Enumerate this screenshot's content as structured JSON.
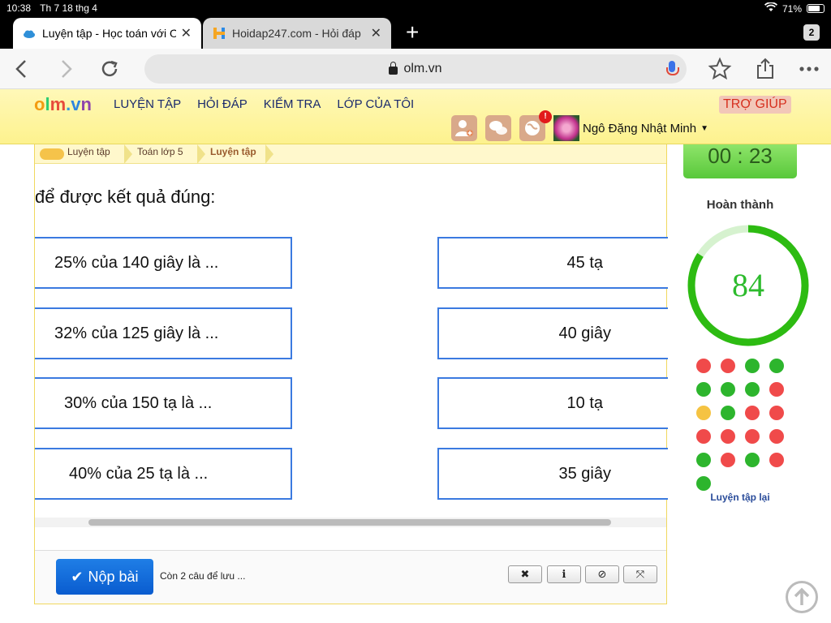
{
  "status": {
    "time": "10:38",
    "date": "Th 7 18 thg 4",
    "battery": "71%"
  },
  "tabs": [
    {
      "title": "Luyện tập - Học toán với O",
      "close": "✕"
    },
    {
      "title": "Hoidap247.com - Hỏi đáp",
      "close": "✕"
    }
  ],
  "tab_count": "2",
  "browser": {
    "url": "olm.vn",
    "new_tab": "+"
  },
  "site": {
    "logo": {
      "o": "o",
      "l": "l",
      "m": "m",
      "dot": ".",
      "v": "v",
      "n": "n"
    },
    "nav": [
      "LUYỆN TẬP",
      "HỎI ĐÁP",
      "KIỂM TRA",
      "LỚP CỦA TÔI"
    ],
    "help": "TRỢ GIÚP",
    "notification_badge": "!",
    "user_name": "Ngô Đặng Nhật Minh"
  },
  "breadcrumb": [
    "Luyện tập",
    "Toán lớp 5",
    "Luyện tập"
  ],
  "question_text": "để được kết quả đúng:",
  "left_items": [
    "25% của 140 giây là ...",
    "32% của 125 giây là ...",
    "30% của 150 tạ là ...",
    "40% của 25 tạ là ..."
  ],
  "right_items": [
    "45 tạ",
    "40 giây",
    "10 tạ",
    "35 giây"
  ],
  "footer": {
    "submit_label": "Nộp bài",
    "remaining": "Còn 2 câu để lưu ...",
    "tools": [
      "✖",
      "ℹ",
      "⊘",
      "⤧"
    ]
  },
  "sidebar": {
    "timer": "00 : 23",
    "progress_title": "Hoàn thành",
    "score": "84",
    "score_max": 100,
    "retry_label": "Luyện tập lại",
    "colors": {
      "correct": "#2db52d",
      "wrong": "#f04a4a",
      "current": "#f5c342"
    },
    "results": [
      "wrong",
      "wrong",
      "correct",
      "correct",
      "correct",
      "correct",
      "correct",
      "wrong",
      "current",
      "correct",
      "wrong",
      "wrong",
      "wrong",
      "wrong",
      "wrong",
      "wrong",
      "correct",
      "wrong",
      "correct",
      "wrong",
      "correct"
    ]
  }
}
